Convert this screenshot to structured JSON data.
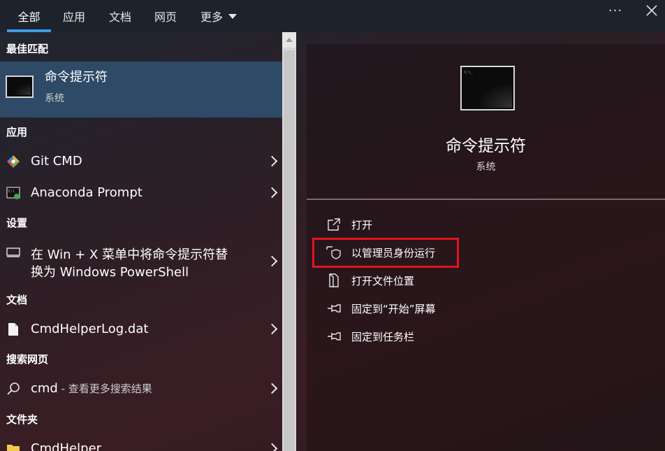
{
  "tabs": [
    {
      "label": "全部",
      "active": true
    },
    {
      "label": "应用",
      "active": false
    },
    {
      "label": "文档",
      "active": false
    },
    {
      "label": "网页",
      "active": false
    },
    {
      "label": "更多",
      "active": false,
      "dropdown": true
    }
  ],
  "window_controls": {
    "more_icon": "ellipsis-icon",
    "more_label": "···",
    "close_icon": "close-icon"
  },
  "left": {
    "best_match_header": "最佳匹配",
    "best_match": {
      "title": "命令提示符",
      "subtitle": "系统",
      "icon": "cmd-icon"
    },
    "apps_header": "应用",
    "apps": [
      {
        "label": "Git CMD",
        "icon": "git-icon"
      },
      {
        "label": "Anaconda Prompt",
        "icon": "anaconda-prompt-icon"
      }
    ],
    "settings_header": "设置",
    "settings": [
      {
        "line1": "在 Win + X 菜单中将命令提示符替",
        "line2": "换为 Windows PowerShell",
        "icon": "monitor-icon"
      }
    ],
    "docs_header": "文档",
    "docs": [
      {
        "label": "CmdHelperLog.dat",
        "icon": "file-icon"
      }
    ],
    "web_header": "搜索网页",
    "web": [
      {
        "label": "cmd",
        "suffix": " - 查看更多搜索结果",
        "icon": "search-icon"
      }
    ],
    "folders_header": "文件夹",
    "folders": [
      {
        "label": "CmdHelper",
        "icon": "folder-icon"
      }
    ]
  },
  "detail": {
    "title": "命令提示符",
    "subtitle": "系统",
    "icon": "cmd-icon",
    "actions": [
      {
        "label": "打开",
        "icon": "open-icon"
      },
      {
        "label": "以管理员身份运行",
        "icon": "shield-icon",
        "highlighted": true
      },
      {
        "label": "打开文件位置",
        "icon": "file-location-icon"
      },
      {
        "label": "固定到“开始”屏幕",
        "icon": "pin-icon"
      },
      {
        "label": "固定到任务栏",
        "icon": "pin-icon"
      }
    ]
  },
  "colors": {
    "accent": "#3b9bea",
    "selected_row": "#2e4a66",
    "highlight_border": "#e5131d"
  }
}
